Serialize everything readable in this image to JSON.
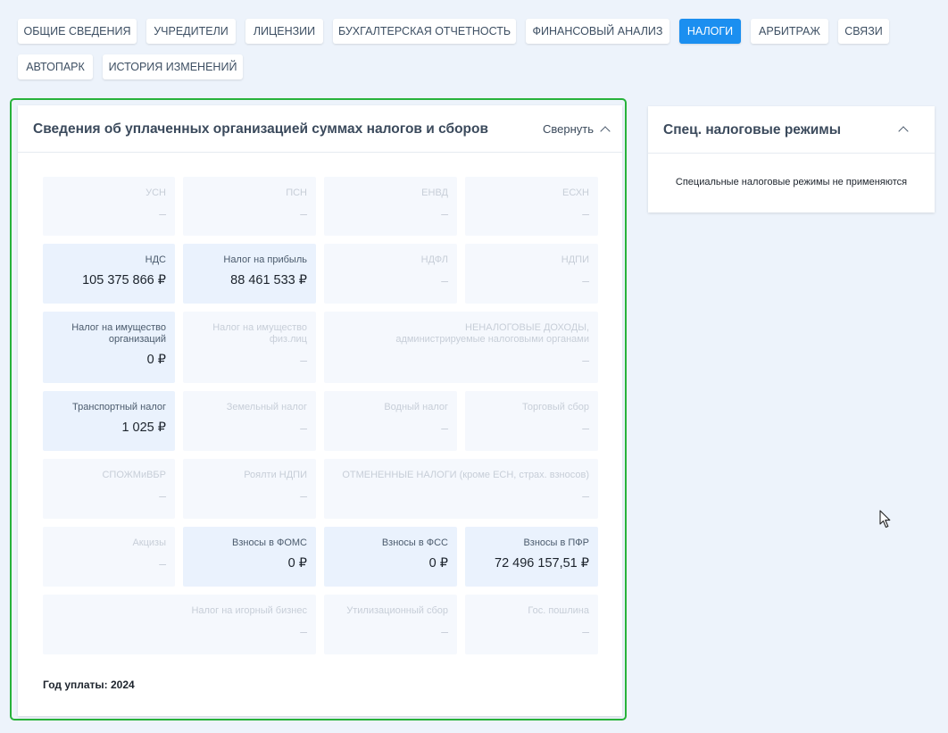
{
  "tabs": [
    {
      "label": "ОБЩИЕ СВЕДЕНИЯ",
      "active": false
    },
    {
      "label": "УЧРЕДИТЕЛИ",
      "active": false
    },
    {
      "label": "ЛИЦЕНЗИИ",
      "active": false
    },
    {
      "label": "БУХГАЛТЕРСКАЯ ОТЧЕТНОСТЬ",
      "active": false
    },
    {
      "label": "ФИНАНСОВЫЙ АНАЛИЗ",
      "active": false
    },
    {
      "label": "НАЛОГИ",
      "active": true
    },
    {
      "label": "АРБИТРАЖ",
      "active": false
    },
    {
      "label": "СВЯЗИ",
      "active": false
    },
    {
      "label": "АВТОПАРК",
      "active": false
    },
    {
      "label": "ИСТОРИЯ ИЗМЕНЕНИЙ",
      "active": false
    }
  ],
  "taxes": {
    "title": "Сведения об уплаченных организацией суммах налогов и сборов",
    "collapse_label": "Свернуть",
    "year_label": "Год уплаты: 2024",
    "cells": [
      {
        "label": "УСН",
        "value": "–",
        "has_value": false
      },
      {
        "label": "ПСН",
        "value": "–",
        "has_value": false
      },
      {
        "label": "ЕНВД",
        "value": "–",
        "has_value": false
      },
      {
        "label": "ЕСХН",
        "value": "–",
        "has_value": false
      },
      {
        "label": "НДС",
        "value": "105 375 866 ₽",
        "has_value": true
      },
      {
        "label": "Налог на прибыль",
        "value": "88 461 533 ₽",
        "has_value": true
      },
      {
        "label": "НДФЛ",
        "value": "–",
        "has_value": false
      },
      {
        "label": "НДПИ",
        "value": "–",
        "has_value": false
      },
      {
        "label": "Налог на имущество организаций",
        "value": "0 ₽",
        "has_value": true
      },
      {
        "label": "Налог на имущество физ.лиц",
        "value": "–",
        "has_value": false
      },
      {
        "label": "НЕНАЛОГОВЫЕ ДОХОДЫ, администрируемые налоговыми органами",
        "value": "–",
        "has_value": false
      },
      {
        "label": "Транспортный налог",
        "value": "1 025 ₽",
        "has_value": true
      },
      {
        "label": "Земельный налог",
        "value": "–",
        "has_value": false
      },
      {
        "label": "Водный налог",
        "value": "–",
        "has_value": false
      },
      {
        "label": "Торговый сбор",
        "value": "–",
        "has_value": false
      },
      {
        "label": "СПОЖМиВБР",
        "value": "–",
        "has_value": false
      },
      {
        "label": "Роялти НДПИ",
        "value": "–",
        "has_value": false
      },
      {
        "label": "ОТМЕНЕННЫЕ НАЛОГИ (кроме ЕСН, страх. взносов)",
        "value": "–",
        "has_value": false
      },
      {
        "label": "Акцизы",
        "value": "–",
        "has_value": false
      },
      {
        "label": "Взносы в ФОМС",
        "value": "0 ₽",
        "has_value": true
      },
      {
        "label": "Взносы в ФСС",
        "value": "0 ₽",
        "has_value": true
      },
      {
        "label": "Взносы в ПФР",
        "value": "72 496 157,51 ₽",
        "has_value": true
      },
      {
        "label": "Налог на игорный бизнес",
        "value": "–",
        "has_value": false
      },
      {
        "label": "Утилизационный сбор",
        "value": "–",
        "has_value": false
      },
      {
        "label": "Гос. пошлина",
        "value": "–",
        "has_value": false
      }
    ]
  },
  "special": {
    "title": "Спец. налоговые режимы",
    "text": "Специальные налоговые режимы не применяются"
  },
  "icons": {
    "collapse": "chevron-up-icon",
    "cursor": "mouse-pointer-icon"
  }
}
